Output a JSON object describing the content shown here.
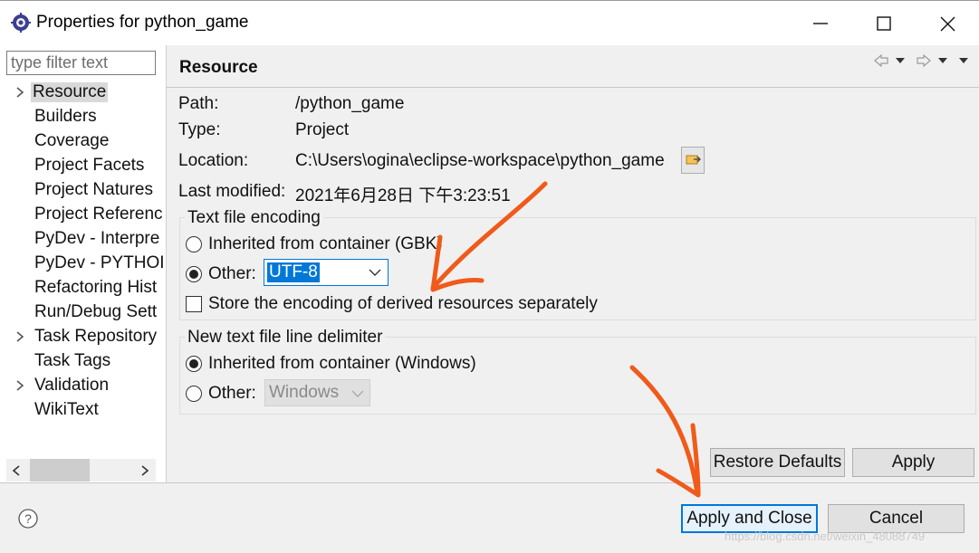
{
  "window": {
    "title": "Properties for python_game",
    "controls": [
      "minimize-icon",
      "maximize-icon",
      "close-icon"
    ]
  },
  "sidebar": {
    "filter_placeholder": "type filter text",
    "items": [
      {
        "label": "Resource",
        "expandable": true,
        "selected": true
      },
      {
        "label": "Builders",
        "expandable": false
      },
      {
        "label": "Coverage",
        "expandable": false
      },
      {
        "label": "Project Facets",
        "expandable": false
      },
      {
        "label": "Project Natures",
        "expandable": false
      },
      {
        "label": "Project Referenc",
        "expandable": false
      },
      {
        "label": "PyDev - Interpre",
        "expandable": false
      },
      {
        "label": "PyDev - PYTHOI",
        "expandable": false
      },
      {
        "label": "Refactoring Hist",
        "expandable": false
      },
      {
        "label": "Run/Debug Sett",
        "expandable": false
      },
      {
        "label": "Task Repository",
        "expandable": true
      },
      {
        "label": "Task Tags",
        "expandable": false
      },
      {
        "label": "Validation",
        "expandable": true
      },
      {
        "label": "WikiText",
        "expandable": false
      }
    ]
  },
  "page": {
    "title": "Resource",
    "nav_icons": [
      "back-arrow-icon",
      "forward-arrow-icon",
      "view-menu-icon"
    ],
    "info": {
      "path_label": "Path:",
      "path_value": "/python_game",
      "type_label": "Type:",
      "type_value": "Project",
      "location_label": "Location:",
      "location_value": "C:\\Users\\ogina\\eclipse-workspace\\python_game",
      "modified_label": "Last modified:",
      "modified_value": "2021年6月28日 下午3:23:51"
    },
    "encoding": {
      "group_title": "Text file encoding",
      "inherited_label": "Inherited from container (GBK)",
      "other_label": "Other:",
      "other_selected": true,
      "other_value": "UTF-8",
      "store_label": "Store the encoding of derived resources separately",
      "store_checked": false
    },
    "delimiter": {
      "group_title": "New text file line delimiter",
      "inherited_label": "Inherited from container (Windows)",
      "inherited_selected": true,
      "other_label": "Other:",
      "other_value": "Windows"
    },
    "restore_defaults_label": "Restore Defaults",
    "apply_label": "Apply"
  },
  "footer": {
    "help_icon": "help-icon",
    "apply_close_label": "Apply and Close",
    "cancel_label": "Cancel"
  },
  "watermark": "https://blog.csdn.net/weixin_48088749",
  "colors": {
    "annotation_arrow": "#f05a1a",
    "selection_blue": "#0078d7",
    "focus_border": "#0078d7"
  }
}
